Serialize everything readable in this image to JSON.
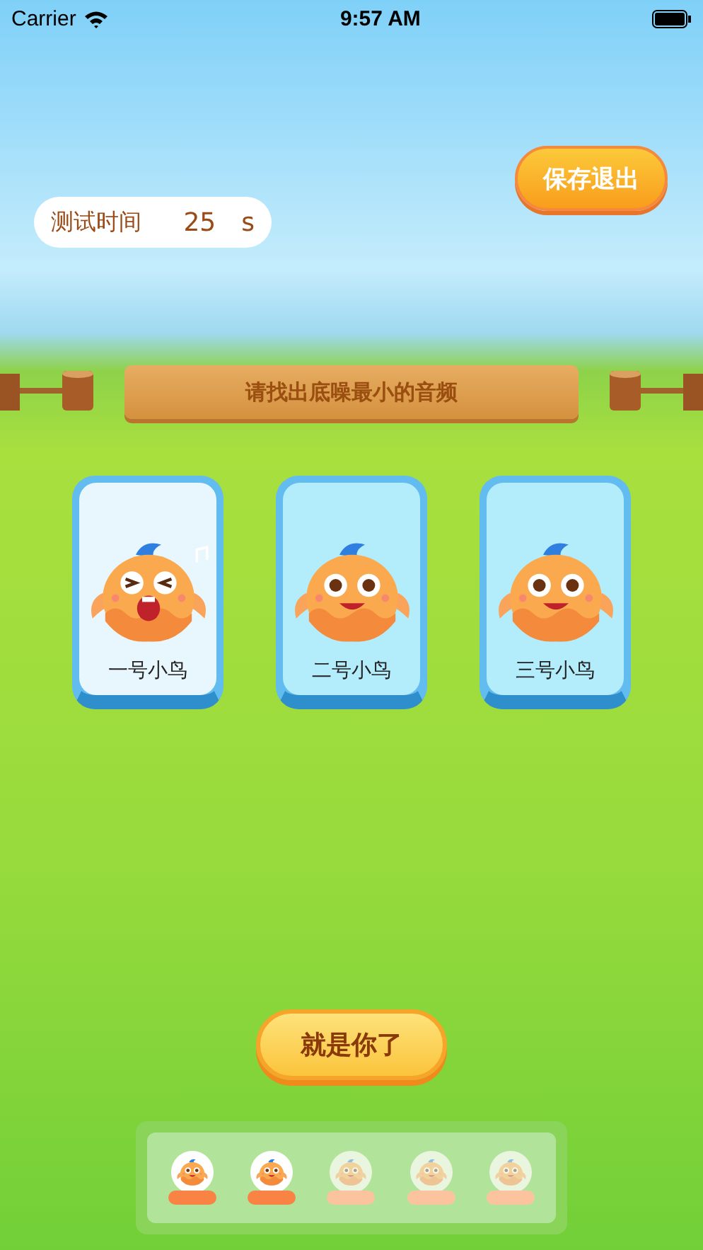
{
  "status_bar": {
    "carrier": "Carrier",
    "time": "9:57 AM"
  },
  "timer": {
    "label": "测试时间",
    "value": "25",
    "unit": "s"
  },
  "save_button": "保存退出",
  "instruction": "请找出底噪最小的音频",
  "birds": [
    {
      "name": "一号小鸟",
      "selected": true
    },
    {
      "name": "二号小鸟",
      "selected": false
    },
    {
      "name": "三号小鸟",
      "selected": false
    }
  ],
  "confirm_button": "就是你了",
  "progress": [
    {
      "done": true
    },
    {
      "done": true
    },
    {
      "done": false
    },
    {
      "done": false
    },
    {
      "done": false
    }
  ]
}
